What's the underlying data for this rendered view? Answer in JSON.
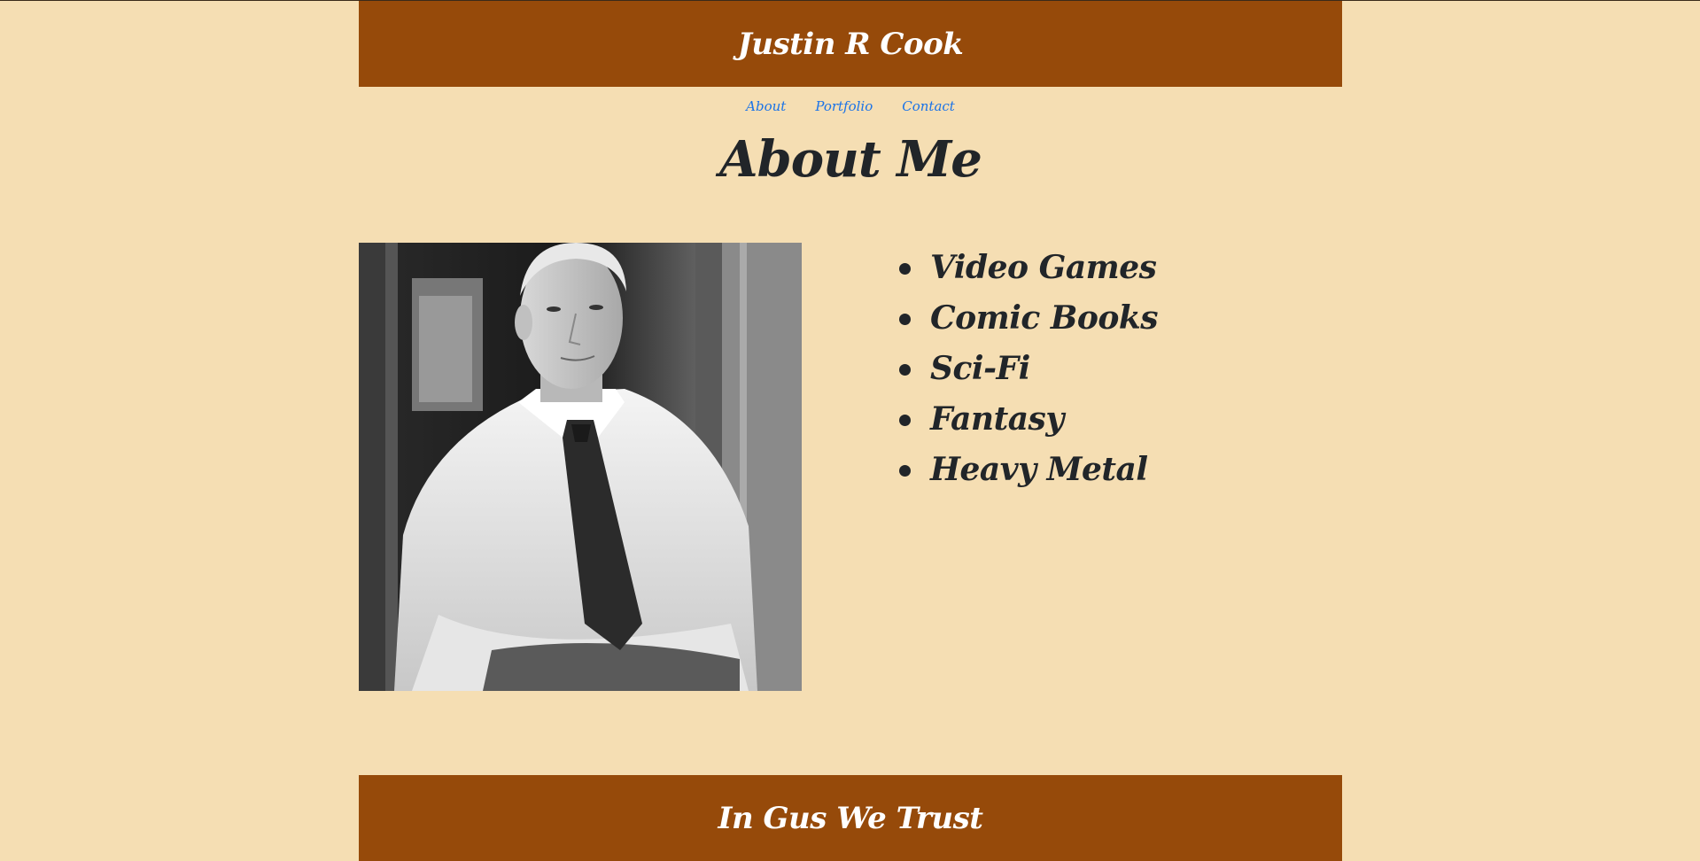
{
  "header": {
    "title": "Justin R Cook"
  },
  "nav": {
    "items": [
      {
        "label": "About"
      },
      {
        "label": "Portfolio"
      },
      {
        "label": "Contact"
      }
    ]
  },
  "main": {
    "heading": "About Me",
    "photo_description": "black-and-white portrait photo",
    "interests": [
      "Video Games",
      "Comic Books",
      "Sci-Fi",
      "Fantasy",
      "Heavy Metal"
    ]
  },
  "footer": {
    "text": "In Gus We Trust"
  },
  "colors": {
    "background": "#f5deb3",
    "header_footer": "#964a0a",
    "link": "#1a73e8",
    "text": "#212529"
  }
}
